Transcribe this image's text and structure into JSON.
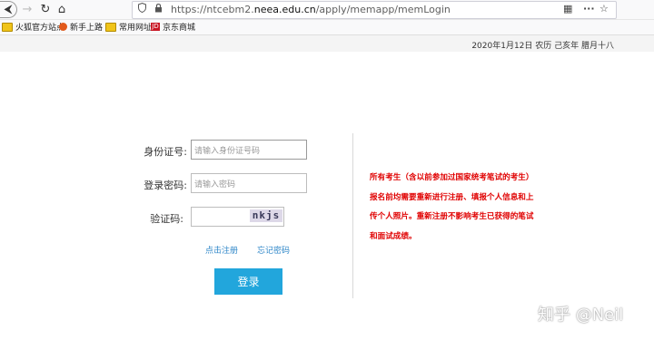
{
  "browser": {
    "url_prefix": "https://ntcebm2.",
    "url_domain": "neea.edu.cn",
    "url_path": "/apply/memapp/memLogin",
    "nav": {
      "back": "⮜",
      "forward": "→",
      "reload": "↻",
      "home": "⌂"
    },
    "url_right_icons": {
      "qr": "▦",
      "more": "···",
      "star": "☆"
    }
  },
  "bookmarks": [
    {
      "label": "火狐官方站点",
      "icon": "folder-icon"
    },
    {
      "label": "新手上路",
      "icon": "firefox-icon"
    },
    {
      "label": "常用网址",
      "icon": "folder-icon"
    },
    {
      "label": "京东商城",
      "icon": "jd-icon",
      "icon_text": "JD"
    }
  ],
  "header": {
    "date": "2020年1月12日 农历 己亥年 腊月十八"
  },
  "form": {
    "id_label": "身份证号:",
    "id_placeholder": "请输入身份证号码",
    "password_label": "登录密码:",
    "password_placeholder": "请输入密码",
    "captcha_label": "验证码:",
    "captcha_text": "nkjs",
    "register_link": "点击注册",
    "forgot_link": "忘记密码",
    "login_button": "登录"
  },
  "notice": {
    "text": "所有考生（含以前参加过国家统考笔试的考生）报名前均需要重新进行注册、填报个人信息和上传个人照片。重新注册不影响考生已获得的笔试和面试成绩。"
  },
  "watermark": "知乎 @Neil",
  "colors": {
    "login_button": "#22a6dc",
    "notice": "#e00000",
    "link": "#2d86c8"
  }
}
